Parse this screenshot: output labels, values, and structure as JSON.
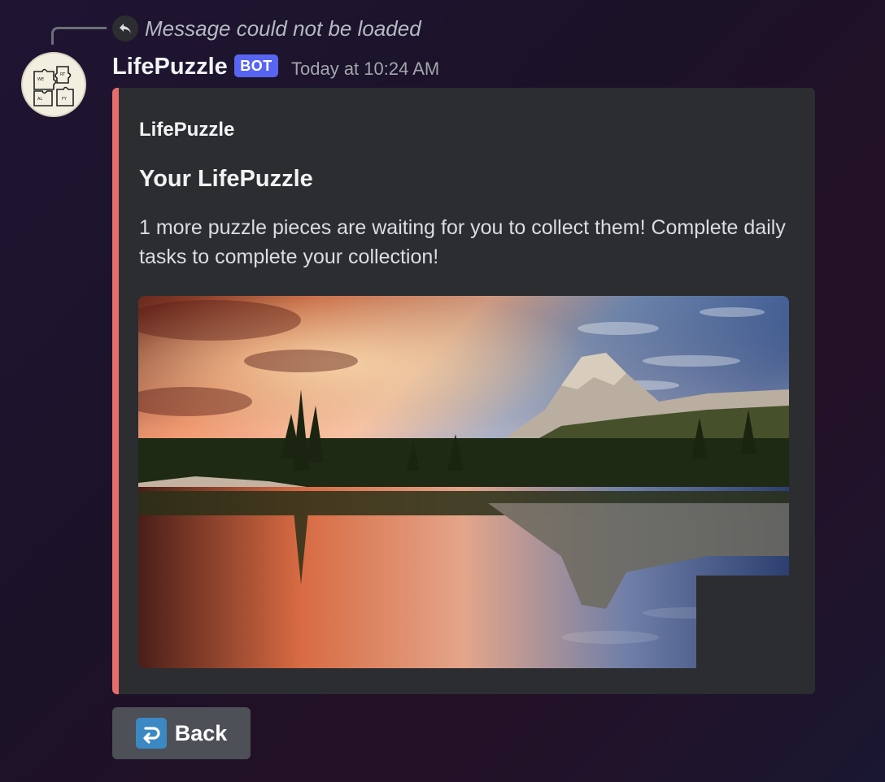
{
  "reply": {
    "text": "Message could not be loaded",
    "icon": "reply-arrow-icon"
  },
  "message": {
    "author": "LifePuzzle",
    "badge": "BOT",
    "timestamp": "Today at 10:24 AM",
    "avatar_icon": "puzzle-pieces-icon"
  },
  "embed": {
    "accent_color": "#e66e6a",
    "author": "LifePuzzle",
    "title": "Your LifePuzzle",
    "description": "1 more puzzle pieces are waiting for you to collect them! Complete daily tasks to complete your collection!",
    "image": "mountain-lake-sunset-puzzle-image"
  },
  "buttons": {
    "back_label": "Back",
    "back_icon": "return-arrow-icon"
  }
}
